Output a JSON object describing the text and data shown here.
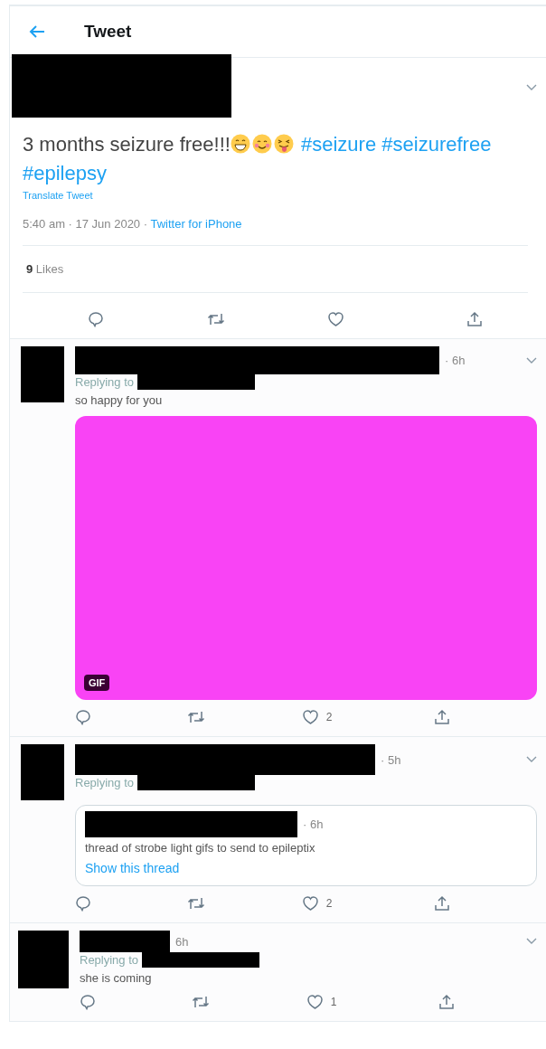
{
  "header": {
    "title": "Tweet"
  },
  "main_tweet": {
    "text": "3 months seizure free!!!",
    "emojis": [
      {
        "kind": "grin"
      },
      {
        "kind": "blush"
      },
      {
        "kind": "tongue"
      }
    ],
    "hashtags": [
      "#seizure",
      "#seizurefree",
      "#epilepsy"
    ],
    "translate": "Translate Tweet",
    "timestamp": "5:40 am · 17 Jun 2020 ·",
    "source": "Twitter for iPhone",
    "likes_count": "9",
    "likes_label": "Likes"
  },
  "replies": [
    {
      "time": "· 6h",
      "replying_to": "Replying to",
      "text": "so happy for you",
      "media": {
        "kind": "gif",
        "badge": "GIF"
      },
      "like_count": "2"
    },
    {
      "time": "· 5h",
      "replying_to": "Replying to",
      "quote": {
        "time": "· 6h",
        "text": "thread of strobe light gifs to send to epileptix",
        "link": "Show this thread"
      },
      "like_count": "2"
    },
    {
      "time": "6h",
      "replying_to": "Replying to",
      "text": "she is coming",
      "like_count": "1"
    }
  ]
}
